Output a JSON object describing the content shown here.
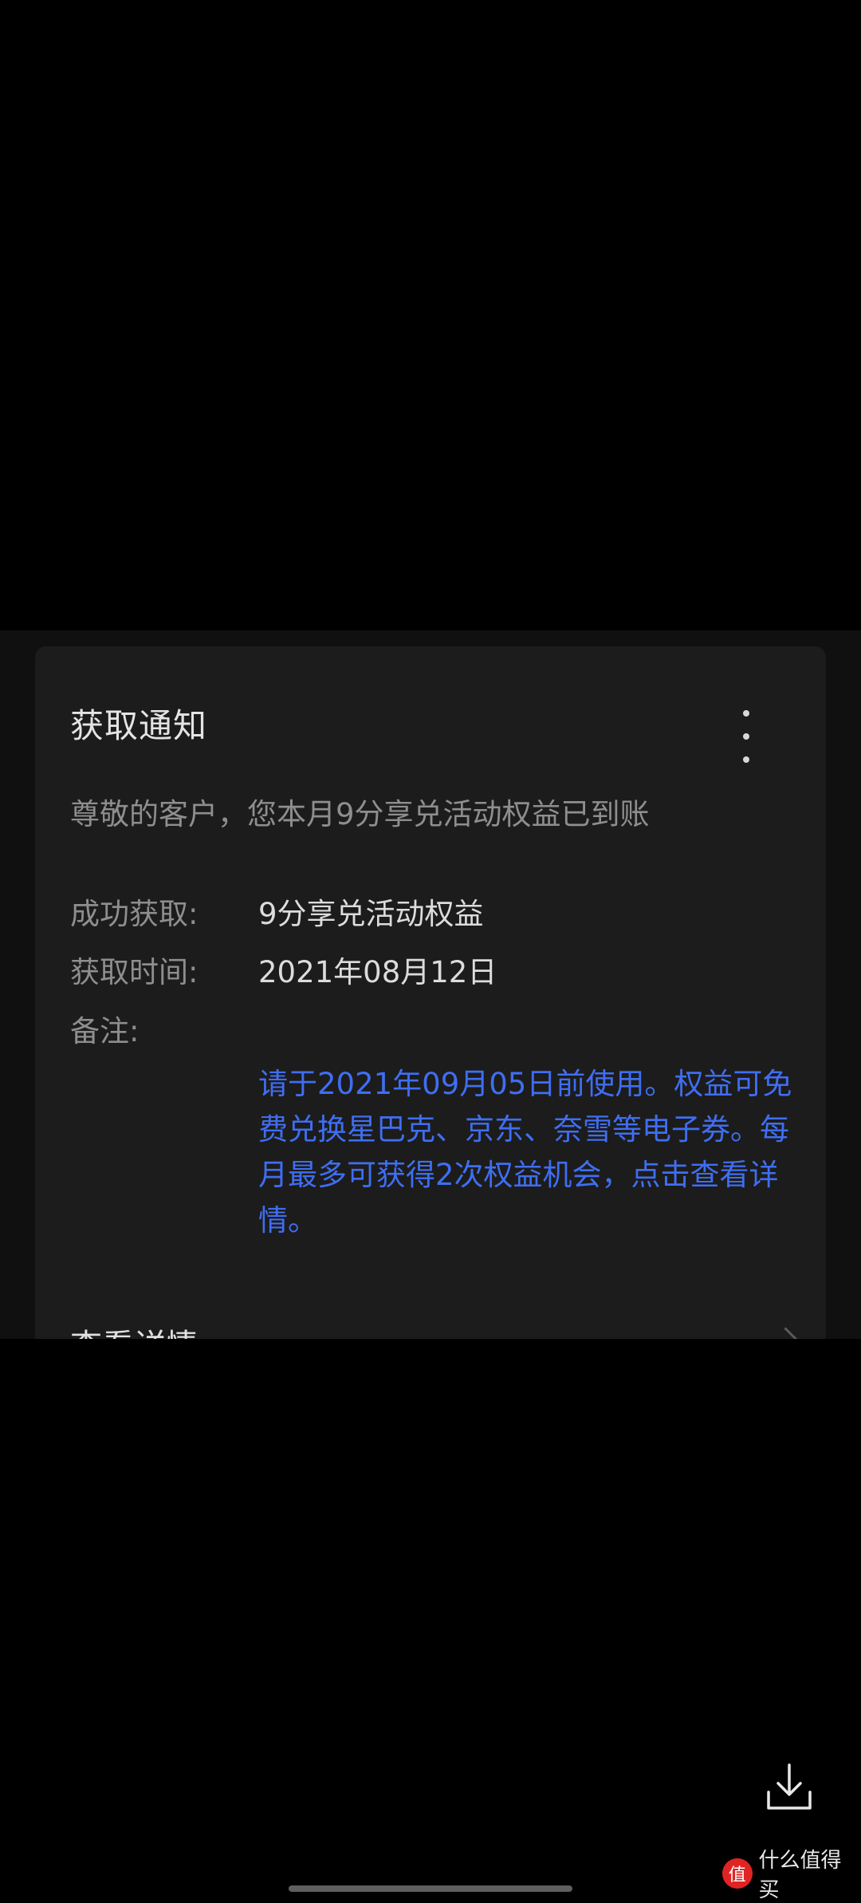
{
  "notification": {
    "title": "获取通知",
    "greeting": "尊敬的客户，您本月9分享兑活动权益已到账",
    "rows": [
      {
        "label": "成功获取:",
        "value": "9分享兑活动权益"
      },
      {
        "label": "获取时间:",
        "value": "2021年08月12日"
      },
      {
        "label": "备注:",
        "value": ""
      }
    ],
    "remark": "请于2021年09月05日前使用。权益可免费兑换星巴克、京东、奈雪等电子券。每月最多可获得2次权益机会，点击查看详情。",
    "detail_label": "查看详情"
  },
  "icons": {
    "more": "more-vertical-icon",
    "chevron": "chevron-right-icon",
    "download": "download-icon",
    "watermark_logo": "值"
  },
  "watermark": {
    "text": "什么值得买"
  },
  "colors": {
    "link": "#3f6ef2",
    "card": "#1c1c1c",
    "brand": "#e02424"
  }
}
